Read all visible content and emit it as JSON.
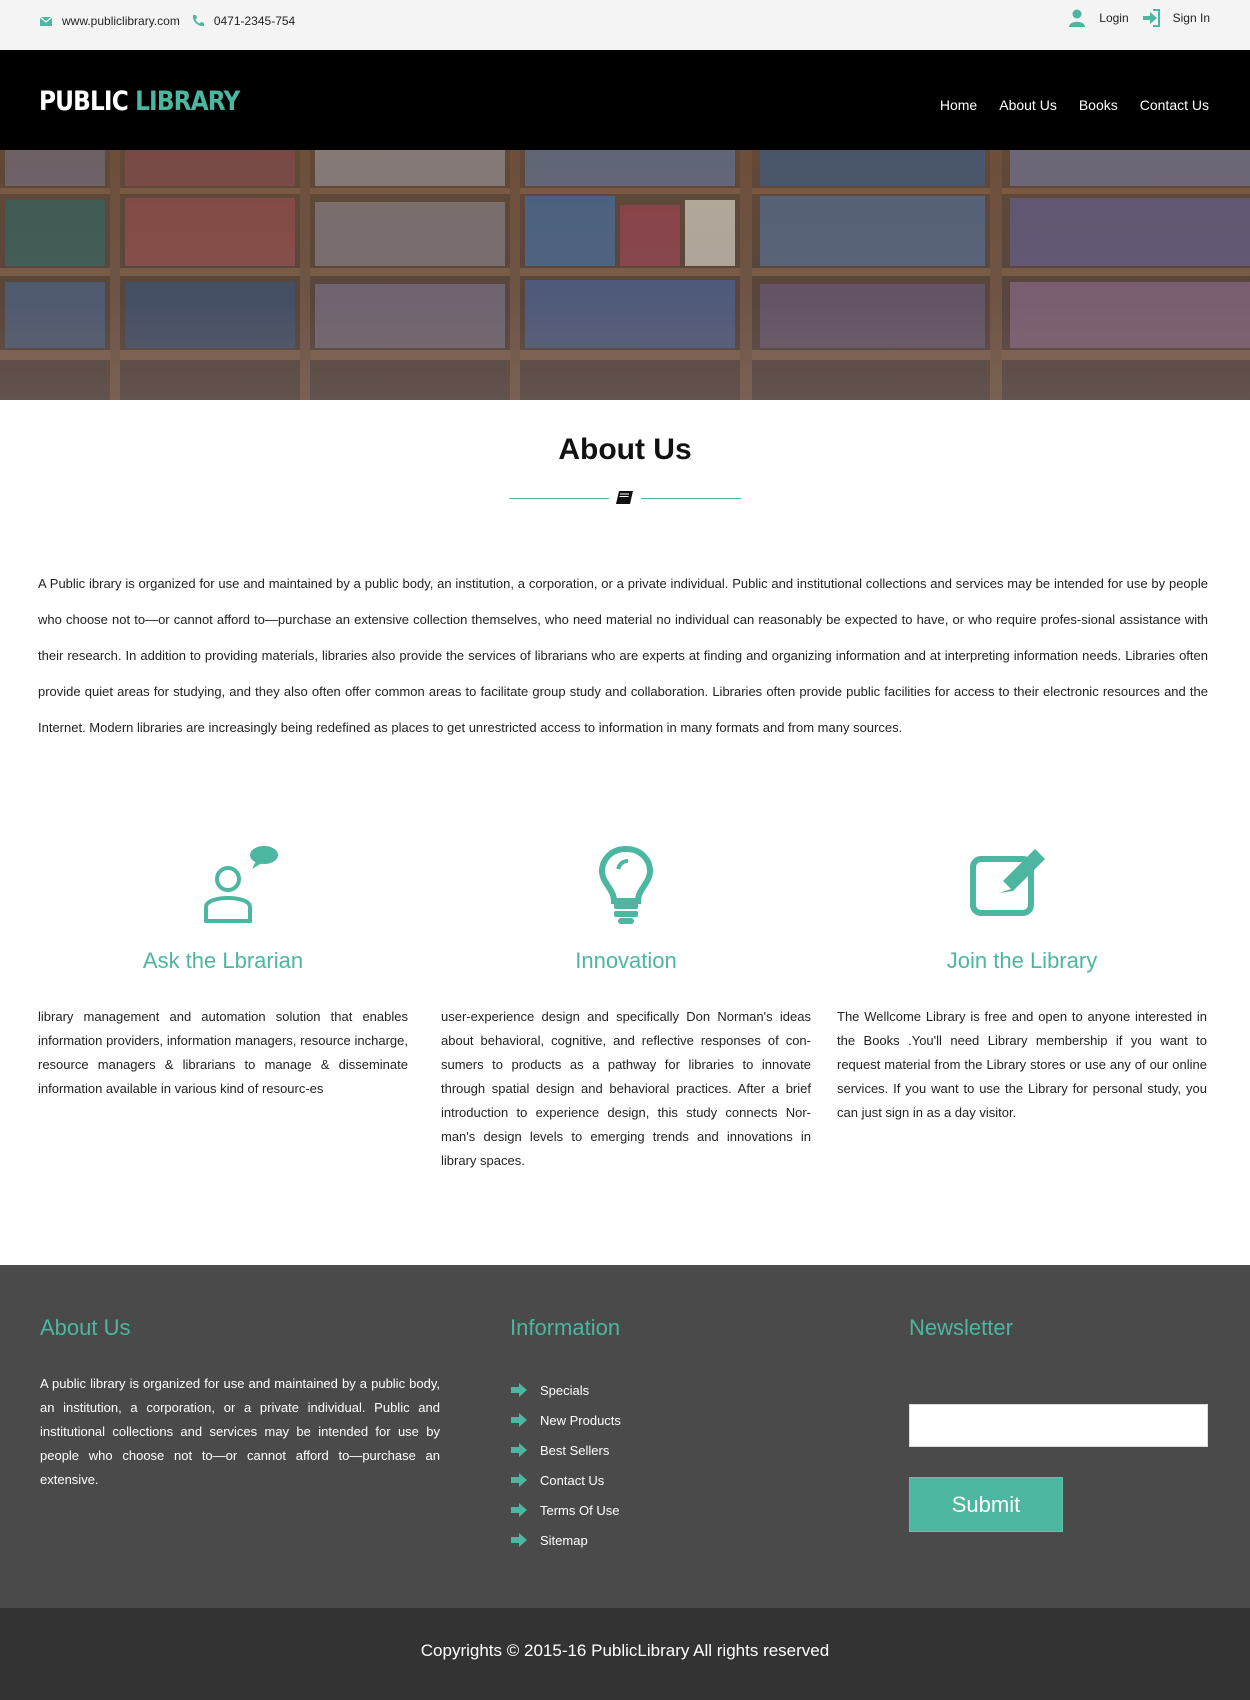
{
  "colors": {
    "accent": "#4db6a0",
    "header_bg": "#000000",
    "footer_bg": "#4a4a4a",
    "copyright_bg": "#333333"
  },
  "topbar": {
    "website": "www.publiclibrary.com",
    "phone": "0471-2345-754",
    "login_label": "Login",
    "signin_label": "Sign In",
    "icons": [
      "envelope-icon",
      "phone-icon",
      "user-icon",
      "sign-in-icon"
    ]
  },
  "header": {
    "logo_part1": "PUBLIC",
    "logo_part2": "LIBRARY",
    "nav": [
      "Home",
      "About Us",
      "Books",
      "Contact Us"
    ]
  },
  "about": {
    "title": "About Us",
    "text": "A Public ibrary is organized for use and maintained by a public body, an institution, a corporation, or a private individual. Public and institutional collections and services may be intended for use by people who choose not to—or cannot afford to—purchase an extensive collection themselves, who need material no individual can reasonably be expected to have, or who require profes-sional assistance with their research. In addition to providing materials, libraries also provide the services of librarians who are experts at finding and organizing information and at interpreting information needs. Libraries often provide quiet areas for studying, and they also often offer common areas to facilitate group study and collaboration. Libraries often provide public facilities for access to their electronic resources and the Internet. Modern libraries are increasingly being redefined as places to get unrestricted access to information in many formats and from many sources."
  },
  "features": [
    {
      "icon": "user-chat-icon",
      "title": "Ask the Lbrarian",
      "text": "library management and automation solution that enables information providers, information managers, resource incharge, resource managers & librarians to manage & disseminate information available in various kind of resourc-es"
    },
    {
      "icon": "lightbulb-icon",
      "title": "Innovation",
      "text": "user-experience design and specifically Don Norman's ideas about behavioral, cognitive, and reflective responses of con-sumers to products as a pathway for libraries to innovate through spatial design and behavioral practices. After a brief introduction to experience design, this study connects Nor-man's design levels to emerging trends and innovations in library spaces."
    },
    {
      "icon": "edit-icon",
      "title": "Join the Library",
      "text": "The Wellcome Library is free and open to anyone interested in the Books .You'll need Library membership if you want to request material from the Library stores or use any of our online services. If you want to use the Library for personal study, you can just sign in as a day visitor."
    }
  ],
  "footer": {
    "about_title": "About Us",
    "about_text": "A public library is organized for use and maintained by a public body, an institution, a corporation, or a private individual. Public and institutional collections and services may be intended for use by people who choose not to—or cannot afford to—purchase an extensive.",
    "info_title": "Information",
    "links": [
      "Specials",
      "New Products",
      "Best Sellers",
      "Contact Us",
      "Terms Of Use",
      "Sitemap"
    ],
    "newsletter_title": "Newsletter",
    "newsletter_value": "",
    "submit_label": "Submit"
  },
  "copyright": "Copyrights © 2015-16 PublicLibrary All rights reserved"
}
